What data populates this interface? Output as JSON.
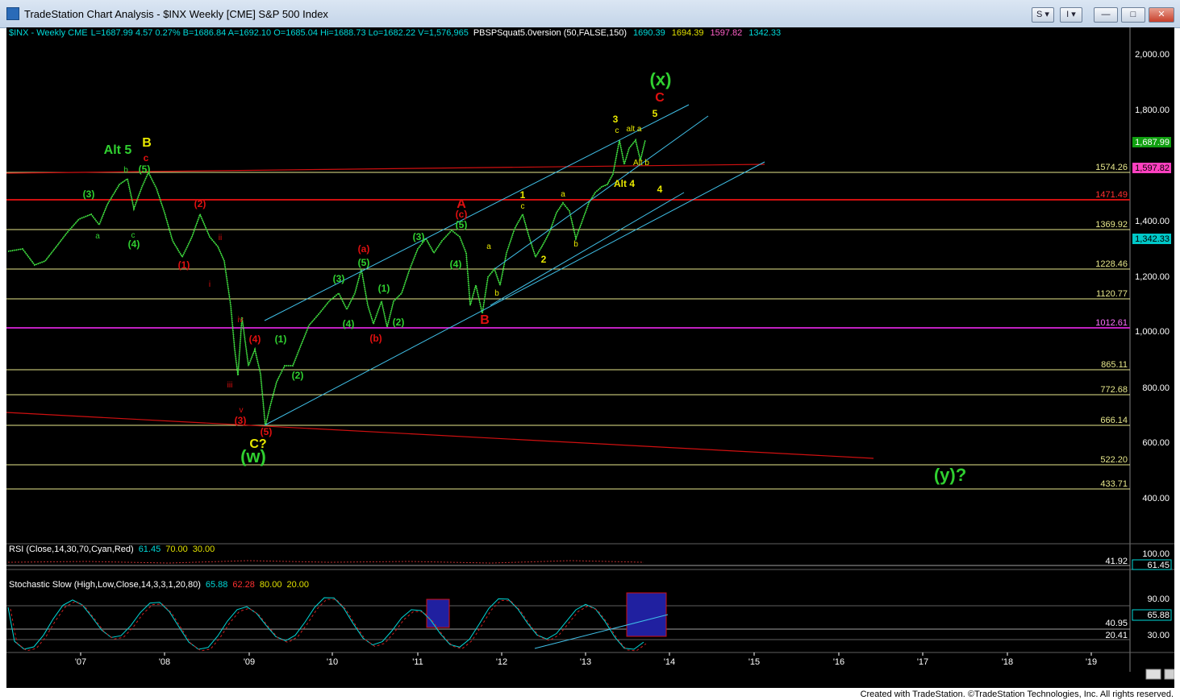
{
  "window": {
    "title": "TradeStation Chart Analysis - $INX Weekly [CME] S&P 500 Index",
    "buttons": [
      {
        "label": "S ▾",
        "name": "style-menu-button"
      },
      {
        "label": "I ▾",
        "name": "indicator-menu-button"
      }
    ]
  },
  "chart_header": {
    "symbol": "$INX - Weekly  CME",
    "stats": "L=1687.99  4.57  0.27%   B=1686.84  A=1692.10  O=1685.04  Hi=1688.73  Lo=1682.22  V=1,576,965",
    "indicator": "PBSPSquat5.0version (50,FALSE,150)",
    "values": [
      {
        "text": "1690.39",
        "color": "#00d8d8"
      },
      {
        "text": "1694.39",
        "color": "#e0e000"
      },
      {
        "text": "1597.82",
        "color": "#ff60c8"
      },
      {
        "text": "1342.33",
        "color": "#00d8d8"
      }
    ]
  },
  "colors": {
    "background": "#000000",
    "price": "#40e040",
    "hline_yellow": "#e8e88c",
    "hline_red": "#d01010",
    "hline_magenta": "#c020c0",
    "channel": "#40c0e8",
    "label_green": "#30d030",
    "label_red": "#e01010",
    "label_yellow": "#e8e800",
    "axis_text": "#ffffff",
    "stoch_box": "#2020a0"
  },
  "axis": {
    "price_ticks": [
      "2,000.00",
      "1,800.00",
      "1,400.00",
      "1,200.00",
      "1,000.00",
      "800.00",
      "600.00",
      "400.00"
    ],
    "level_labels": [
      {
        "text": "1574.26",
        "style": "yellow"
      },
      {
        "text": "1471.49",
        "style": "red"
      },
      {
        "text": "1369.92",
        "style": "yellow"
      },
      {
        "text": "1228.46",
        "style": "yellow"
      },
      {
        "text": "1120.77",
        "style": "yellow"
      },
      {
        "text": "1012.61",
        "style": "magenta"
      },
      {
        "text": "865.11",
        "style": "yellow"
      },
      {
        "text": "772.68",
        "style": "yellow"
      },
      {
        "text": "666.14",
        "style": "yellow"
      },
      {
        "text": "522.20",
        "style": "yellow"
      },
      {
        "text": "433.71",
        "style": "yellow"
      }
    ],
    "flags": [
      {
        "text": "1,687.99",
        "bg": "#10a010",
        "fg": "#ffffff"
      },
      {
        "text": "1,597.82",
        "bg": "#ff40c0",
        "fg": "#000000"
      },
      {
        "text": "1,342.33",
        "bg": "#00c8c8",
        "fg": "#000000"
      }
    ],
    "x_ticks": [
      "'07",
      "'08",
      "'09",
      "'10",
      "'11",
      "'12",
      "'13",
      "'14",
      "'15",
      "'16",
      "'17",
      "'18",
      "'19"
    ]
  },
  "wave_labels": [
    {
      "text": "(x)",
      "color": "green",
      "size": "big"
    },
    {
      "text": "C",
      "color": "red",
      "size": "mid"
    },
    {
      "text": "5",
      "color": "yellow",
      "size": "sm"
    },
    {
      "text": "3",
      "color": "yellow",
      "size": "sm"
    },
    {
      "text": "c",
      "color": "yellow",
      "size": "xs"
    },
    {
      "text": "alt a",
      "color": "yellow",
      "size": "xs"
    },
    {
      "text": "Alt b",
      "color": "yellow",
      "size": "xs"
    },
    {
      "text": "Alt 4",
      "color": "yellow",
      "size": "sm"
    },
    {
      "text": "4",
      "color": "yellow",
      "size": "sm"
    },
    {
      "text": "Alt 5",
      "color": "green",
      "size": "mid"
    },
    {
      "text": "B",
      "color": "yellow",
      "size": "mid"
    },
    {
      "text": "c",
      "color": "red",
      "size": "sm"
    },
    {
      "text": "b",
      "color": "green",
      "size": "xs"
    },
    {
      "text": "(5)",
      "color": "green",
      "size": "sm"
    },
    {
      "text": "(3)",
      "color": "green",
      "size": "sm"
    },
    {
      "text": "a",
      "color": "green",
      "size": "xs"
    },
    {
      "text": "c",
      "color": "green",
      "size": "xs"
    },
    {
      "text": "(4)",
      "color": "green",
      "size": "sm"
    },
    {
      "text": "(2)",
      "color": "red",
      "size": "sm"
    },
    {
      "text": "(1)",
      "color": "red",
      "size": "sm"
    },
    {
      "text": "ii",
      "color": "red",
      "size": "xs"
    },
    {
      "text": "i",
      "color": "red",
      "size": "xs"
    },
    {
      "text": "iv",
      "color": "red",
      "size": "xs"
    },
    {
      "text": "iii",
      "color": "red",
      "size": "xs"
    },
    {
      "text": "v",
      "color": "red",
      "size": "xs"
    },
    {
      "text": "(3)",
      "color": "red",
      "size": "sm"
    },
    {
      "text": "(4)",
      "color": "red",
      "size": "sm"
    },
    {
      "text": "(5)",
      "color": "red",
      "size": "sm"
    },
    {
      "text": "C?",
      "color": "yellow",
      "size": "mid"
    },
    {
      "text": "(w)",
      "color": "green",
      "size": "big"
    },
    {
      "text": "(1)",
      "color": "green",
      "size": "sm"
    },
    {
      "text": "(2)",
      "color": "green",
      "size": "sm"
    },
    {
      "text": "(3)",
      "color": "green",
      "size": "sm"
    },
    {
      "text": "(4)",
      "color": "green",
      "size": "sm"
    },
    {
      "text": "(a)",
      "color": "red",
      "size": "sm"
    },
    {
      "text": "(5)",
      "color": "green",
      "size": "sm"
    },
    {
      "text": "(b)",
      "color": "red",
      "size": "sm"
    },
    {
      "text": "(1)",
      "color": "green",
      "size": "sm"
    },
    {
      "text": "(2)",
      "color": "green",
      "size": "sm"
    },
    {
      "text": "(3)",
      "color": "green",
      "size": "sm"
    },
    {
      "text": "A",
      "color": "red",
      "size": "mid"
    },
    {
      "text": "(c)",
      "color": "red",
      "size": "sm"
    },
    {
      "text": "(5)",
      "color": "green",
      "size": "sm"
    },
    {
      "text": "(4)",
      "color": "green",
      "size": "sm"
    },
    {
      "text": "B",
      "color": "red",
      "size": "mid"
    },
    {
      "text": "a",
      "color": "yellow",
      "size": "xs"
    },
    {
      "text": "b",
      "color": "yellow",
      "size": "xs"
    },
    {
      "text": "1",
      "color": "yellow",
      "size": "sm"
    },
    {
      "text": "c",
      "color": "yellow",
      "size": "xs"
    },
    {
      "text": "2",
      "color": "yellow",
      "size": "sm"
    },
    {
      "text": "a",
      "color": "yellow",
      "size": "xs"
    },
    {
      "text": "b",
      "color": "yellow",
      "size": "xs"
    },
    {
      "text": "(y)?",
      "color": "green",
      "size": "big"
    }
  ],
  "rsi": {
    "label": "RSI (Close,14,30,70,Cyan,Red)",
    "values": [
      {
        "text": "61.45",
        "color": "#00d8d8"
      },
      {
        "text": "70.00",
        "color": "#e0e000"
      },
      {
        "text": "30.00",
        "color": "#e0e000"
      }
    ],
    "axis_top": "100.00",
    "level_label": "41.92",
    "flag": "61.45"
  },
  "stochastic": {
    "label": "Stochastic Slow (High,Low,Close,14,3,3,1,20,80)",
    "values": [
      {
        "text": "65.88",
        "color": "#00d8d8"
      },
      {
        "text": "62.28",
        "color": "#ff3030"
      },
      {
        "text": "80.00",
        "color": "#e0e000"
      },
      {
        "text": "20.00",
        "color": "#e0e000"
      }
    ],
    "axis_ticks": [
      "90.00",
      "30.00"
    ],
    "level_labels": [
      "40.95",
      "20.41"
    ],
    "flag": "65.88"
  },
  "footer": "Created with TradeStation. ©TradeStation Technologies, Inc. All rights reserved."
}
